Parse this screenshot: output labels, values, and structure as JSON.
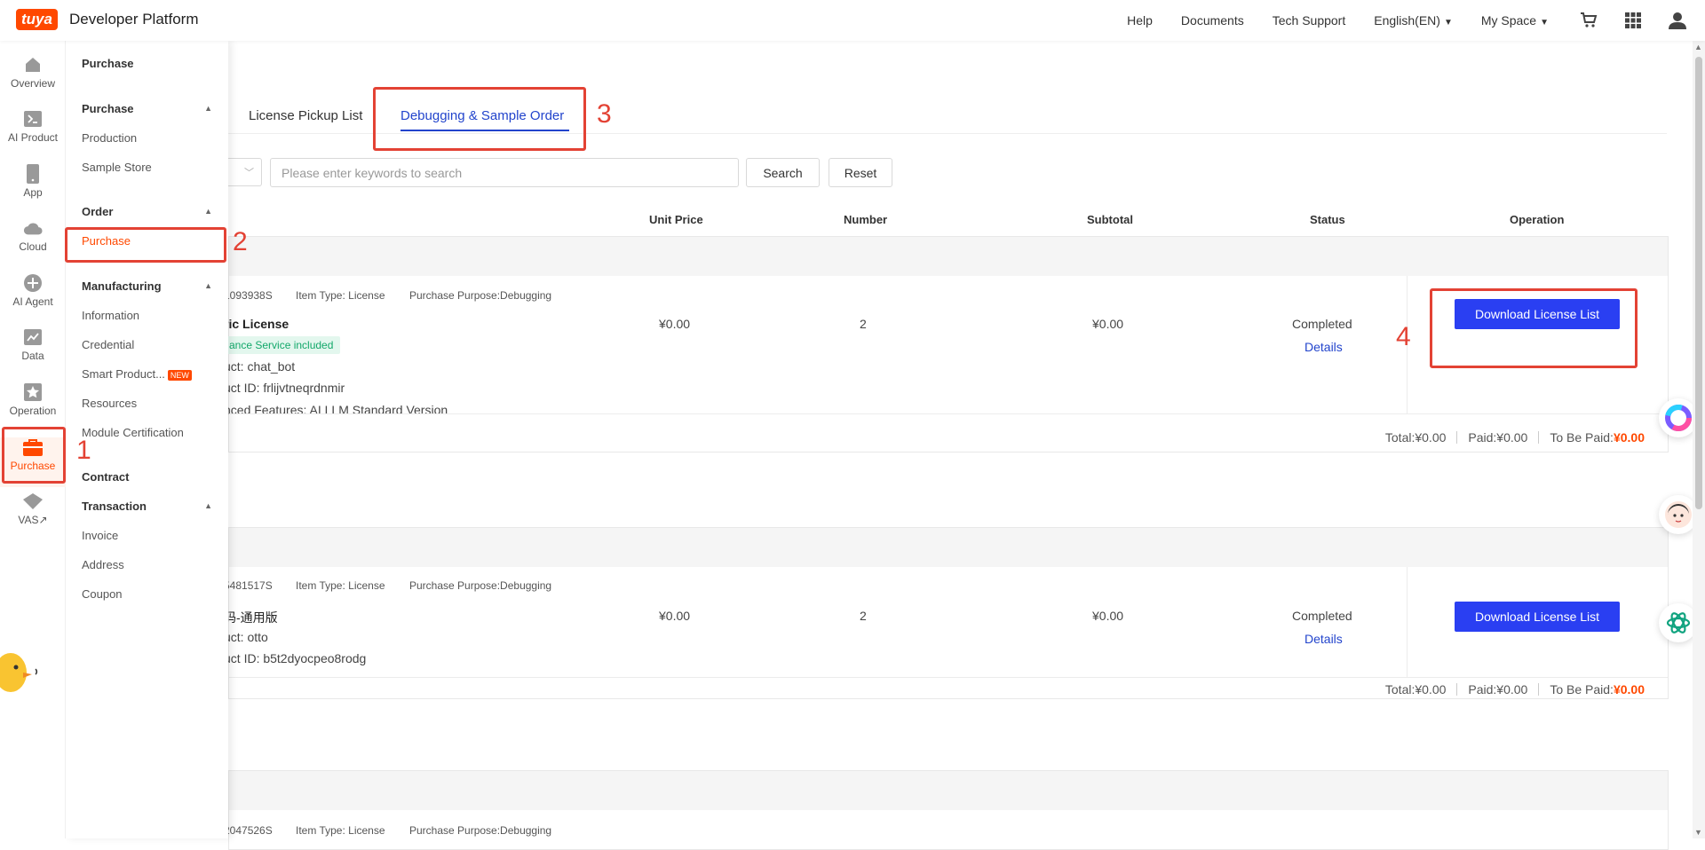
{
  "header": {
    "logo": "tuya",
    "brand": "Developer Platform",
    "nav": [
      "Help",
      "Documents",
      "Tech Support"
    ],
    "language": "English(EN)",
    "space": "My Space"
  },
  "rail": {
    "items": [
      {
        "label": "Overview",
        "icon": "home-icon"
      },
      {
        "label": "AI Product",
        "icon": "terminal-icon"
      },
      {
        "label": "App",
        "icon": "phone-icon"
      },
      {
        "label": "Cloud",
        "icon": "cloud-icon"
      },
      {
        "label": "AI Agent",
        "icon": "agent-icon"
      },
      {
        "label": "Data",
        "icon": "chart-icon"
      },
      {
        "label": "Operation",
        "icon": "star-icon"
      },
      {
        "label": "Purchase",
        "icon": "bag-icon"
      },
      {
        "label": "VAS",
        "icon": "diamond-icon"
      }
    ],
    "vas_suffix": "↗"
  },
  "submenu": {
    "title": "Purchase",
    "purchase_group": "Purchase",
    "production": "Production",
    "sample_store": "Sample Store",
    "order_group": "Order",
    "order_purchase": "Purchase",
    "manufacturing_group": "Manufacturing",
    "information": "Information",
    "credential": "Credential",
    "smart_product": "Smart Product...",
    "new_badge": "NEW",
    "resources": "Resources",
    "module_cert": "Module Certification",
    "contract": "Contract",
    "transaction_group": "Transaction",
    "invoice": "Invoice",
    "address": "Address",
    "coupon": "Coupon"
  },
  "tabs": {
    "pickup": "License Pickup List",
    "debug": "Debugging & Sample Order"
  },
  "search": {
    "placeholder": "Please enter keywords to search",
    "search_btn": "Search",
    "reset_btn": "Reset"
  },
  "columns": {
    "unit_price": "Unit Price",
    "number": "Number",
    "subtotal": "Subtotal",
    "status": "Status",
    "operation": "Operation"
  },
  "orders": [
    {
      "order_no": "1093938S",
      "item_type": "Item Type: License",
      "purpose": "Purchase Purpose:Debugging",
      "product_name": "ric License",
      "badge": "ance Service included",
      "lines": [
        "uct: chat_bot",
        "uct ID: frlijvtneqrdnmir",
        "nced Features: AI LLM Standard Version"
      ],
      "unit_price": "¥0.00",
      "number": "2",
      "subtotal": "¥0.00",
      "status": "Completed",
      "details": "Details",
      "button": "Download License List",
      "total": "Total:¥0.00",
      "paid": "Paid:¥0.00",
      "to_be_paid_label": "To Be Paid:",
      "to_be_paid": "¥0.00"
    },
    {
      "order_no": "5481517S",
      "item_type": "Item Type: License",
      "purpose": "Purchase Purpose:Debugging",
      "product_name": "码-通用版",
      "lines": [
        "uct: otto",
        "uct ID: b5t2dyocpeo8rodg"
      ],
      "unit_price": "¥0.00",
      "number": "2",
      "subtotal": "¥0.00",
      "status": "Completed",
      "details": "Details",
      "button": "Download License List",
      "total": "Total:¥0.00",
      "paid": "Paid:¥0.00",
      "to_be_paid_label": "To Be Paid:",
      "to_be_paid": "¥0.00"
    },
    {
      "order_no": "2047526S",
      "item_type": "Item Type: License",
      "purpose": "Purchase Purpose:Debugging"
    }
  ],
  "annotations": [
    "1",
    "2",
    "3",
    "4"
  ],
  "colors": {
    "brand": "#ff4800",
    "primary": "#2a3ff2",
    "annotation": "#e34234",
    "success": "#12a86a"
  }
}
